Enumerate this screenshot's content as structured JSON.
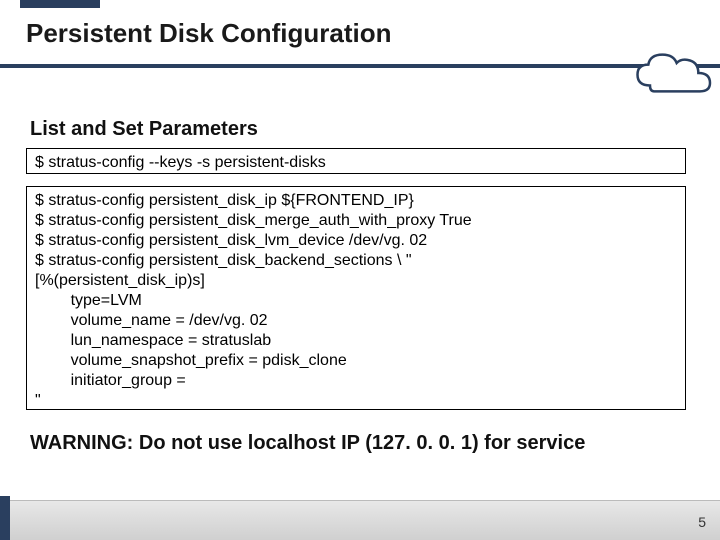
{
  "title": "Persistent Disk Configuration",
  "subheading": "List and Set Parameters",
  "code_box_1": "$ stratus-config --keys -s persistent-disks",
  "code_box_2": "$ stratus-config persistent_disk_ip ${FRONTEND_IP}\n$ stratus-config persistent_disk_merge_auth_with_proxy True\n$ stratus-config persistent_disk_lvm_device /dev/vg. 02\n$ stratus-config persistent_disk_backend_sections \\ \"\n[%(persistent_disk_ip)s]\n        type=LVM\n        volume_name = /dev/vg. 02\n        lun_namespace = stratuslab\n        volume_snapshot_prefix = pdisk_clone\n        initiator_group =\n\"",
  "warning": "WARNING: Do not use localhost IP (127. 0. 0. 1) for service",
  "page_number": "5"
}
